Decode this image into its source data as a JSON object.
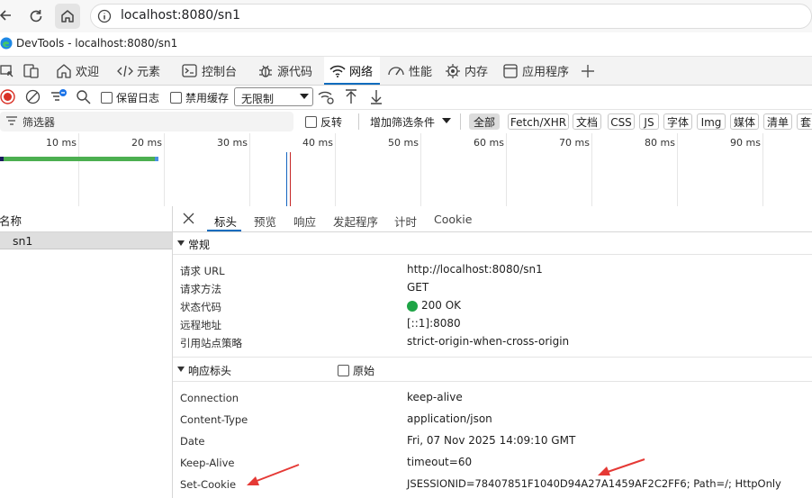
{
  "browser": {
    "url": "localhost:8080/sn1"
  },
  "devtools": {
    "title": "DevTools - localhost:8080/sn1",
    "tabs": [
      {
        "label": "欢迎",
        "icon": "home-icon"
      },
      {
        "label": "元素",
        "icon": "code-icon"
      },
      {
        "label": "控制台",
        "icon": "console-icon"
      },
      {
        "label": "源代码",
        "icon": "bug-icon"
      },
      {
        "label": "网络",
        "icon": "wifi-icon",
        "active": true
      },
      {
        "label": "性能",
        "icon": "performance-icon"
      },
      {
        "label": "内存",
        "icon": "memory-icon"
      },
      {
        "label": "应用程序",
        "icon": "application-icon"
      }
    ]
  },
  "toolbar": {
    "preserve_log": "保留日志",
    "disable_cache": "禁用缓存",
    "throttle": "无限制"
  },
  "filter": {
    "placeholder": "筛选器",
    "invert": "反转",
    "more_filters": "增加筛选条件",
    "chips": [
      "全部",
      "Fetch/XHR",
      "文档",
      "CSS",
      "JS",
      "字体",
      "Img",
      "媒体",
      "清单",
      "套"
    ]
  },
  "timeline": {
    "ticks": [
      "10 ms",
      "20 ms",
      "30 ms",
      "40 ms",
      "50 ms",
      "60 ms",
      "70 ms",
      "80 ms",
      "90 ms"
    ]
  },
  "requests": {
    "header": "名称",
    "rows": [
      "sn1"
    ]
  },
  "detail": {
    "tabs": [
      "标头",
      "预览",
      "响应",
      "发起程序",
      "计时",
      "Cookie"
    ],
    "active_tab": "标头",
    "general": {
      "title": "常规",
      "rows": [
        {
          "key": "请求 URL",
          "value": "http://localhost:8080/sn1"
        },
        {
          "key": "请求方法",
          "value": "GET"
        },
        {
          "key": "状态代码",
          "value": "200 OK"
        },
        {
          "key": "远程地址",
          "value": "[::1]:8080"
        },
        {
          "key": "引用站点策略",
          "value": "strict-origin-when-cross-origin"
        }
      ]
    },
    "response_headers": {
      "title": "响应标头",
      "raw_label": "原始",
      "rows": [
        {
          "key": "Connection",
          "value": "keep-alive"
        },
        {
          "key": "Content-Type",
          "value": "application/json"
        },
        {
          "key": "Date",
          "value": "Fri, 07 Nov 2025 14:09:10 GMT"
        },
        {
          "key": "Keep-Alive",
          "value": "timeout=60"
        },
        {
          "key": "Set-Cookie",
          "value": "JSESSIONID=78407851F1040D94A27A1459AF2C2FF6; Path=/; HttpOnly"
        }
      ]
    }
  },
  "colors": {
    "accent": "#0f6cbd",
    "status_ok": "#1ea446",
    "annotation": "#e53935"
  }
}
